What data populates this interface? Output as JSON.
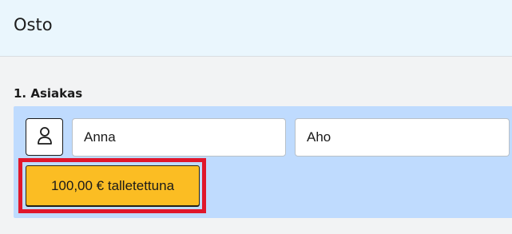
{
  "header": {
    "title": "Osto"
  },
  "customer_section": {
    "title": "1. Asiakas",
    "avatar_icon": "user-icon",
    "first_name": "Anna",
    "last_name": "Aho",
    "deposit_button_label": "100,00 € talletettuna"
  },
  "colors": {
    "header_bg": "#eaf6fd",
    "panel_bg": "#bfdbfe",
    "deposit_button_bg": "#fbbd23",
    "highlight_border": "#e0162b"
  }
}
